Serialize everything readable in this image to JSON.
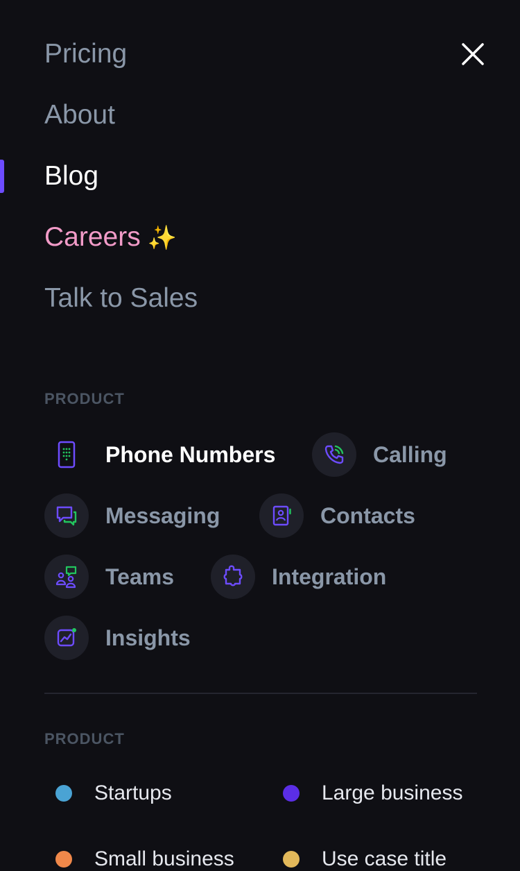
{
  "nav": {
    "items": [
      {
        "label": "Pricing"
      },
      {
        "label": "About"
      },
      {
        "label": "Blog"
      },
      {
        "label": "Careers",
        "emoji": "✨"
      },
      {
        "label": "Talk to Sales"
      }
    ],
    "active": "Blog"
  },
  "product_section": {
    "heading": "PRODUCT",
    "items": [
      {
        "label": "Phone Numbers",
        "icon": "phone-keypad-icon"
      },
      {
        "label": "Calling",
        "icon": "phone-call-icon"
      },
      {
        "label": "Messaging",
        "icon": "chat-bubbles-icon"
      },
      {
        "label": "Contacts",
        "icon": "contact-book-icon"
      },
      {
        "label": "Teams",
        "icon": "team-icon"
      },
      {
        "label": "Integration",
        "icon": "puzzle-icon"
      },
      {
        "label": "Insights",
        "icon": "chart-icon"
      }
    ]
  },
  "use_case_section": {
    "heading": "PRODUCT",
    "items": [
      {
        "label": "Startups",
        "color": "#4aa3d4"
      },
      {
        "label": "Large business",
        "color": "#5b2ee6"
      },
      {
        "label": "Small business",
        "color": "#f0884a"
      },
      {
        "label": "Use case title",
        "color": "#e2b85a"
      }
    ]
  },
  "colors": {
    "accent": "#6d4cff",
    "green": "#22c55e",
    "careers": "#f29bc8"
  }
}
